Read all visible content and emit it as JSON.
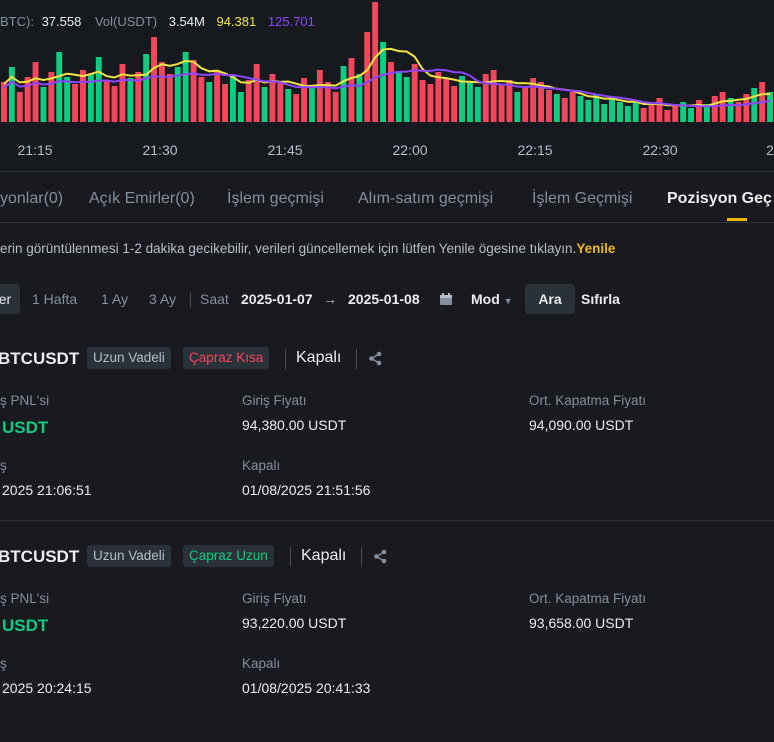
{
  "chart": {
    "legend": {
      "label_prefix": "BTC):",
      "value": "37.558",
      "vol_label": "Vol(USDT)",
      "vol_value": "3.54M",
      "ma1_value": "94.381",
      "ma2_value": "125.701"
    },
    "colors": {
      "up": "#0ecb81",
      "down": "#f6465d",
      "ma_yellow": "#f0e442",
      "ma_purple": "#8c44ff"
    },
    "time_ticks": [
      "21:15",
      "21:30",
      "21:45",
      "22:00",
      "22:15",
      "22:30",
      "2"
    ]
  },
  "tabs": [
    {
      "label": "yonlar(0)"
    },
    {
      "label": "Açık Emirler(0)"
    },
    {
      "label": "İşlem geçmişi"
    },
    {
      "label": "Alım-satım geçmişi"
    },
    {
      "label": "İşlem Geçmişi"
    },
    {
      "label": "Pozisyon Geç"
    }
  ],
  "notice": {
    "text": "erin görüntülenmesi 1-2 dakika gecikebilir, verileri güncellemek için lütfen Yenile ögesine tıklayın.",
    "refresh": "Yenile"
  },
  "filters": {
    "active_chip": "er",
    "week": "1 Hafta",
    "month": "1 Ay",
    "three_month": "3 Ay",
    "time_label": "Saat",
    "date_from": "2025-01-07",
    "arrow": "→",
    "date_to": "2025-01-08",
    "mode": "Mod",
    "search": "Ara",
    "reset": "Sıfırla"
  },
  "positions": [
    {
      "symbol": "BTCUSDT",
      "type": "Uzun Vadeli",
      "side": "Çapraz Kısa",
      "side_color": "red",
      "status": "Kapalı",
      "pnl_label": "ş PNL'si",
      "pnl_value": "USDT",
      "entry_label": "Giriş Fiyatı",
      "entry_value": "94,380.00 USDT",
      "close_label": "Ort. Kapatma Fiyatı",
      "close_value": "94,090.00 USDT",
      "open_label": "ş",
      "open_time": "2025 21:06:51",
      "closed_label": "Kapalı",
      "closed_time": "01/08/2025 21:51:56"
    },
    {
      "symbol": "BTCUSDT",
      "type": "Uzun Vadeli",
      "side": "Çapraz Uzun",
      "side_color": "green",
      "status": "Kapalı",
      "pnl_label": "ş PNL'si",
      "pnl_value": "USDT",
      "entry_label": "Giriş Fiyatı",
      "entry_value": "93,220.00 USDT",
      "close_label": "Ort. Kapatma Fiyatı",
      "close_value": "93,658.00 USDT",
      "open_label": "ş",
      "open_time": "2025 20:24:15",
      "closed_label": "Kapalı",
      "closed_time": "01/08/2025 20:41:33"
    }
  ]
}
